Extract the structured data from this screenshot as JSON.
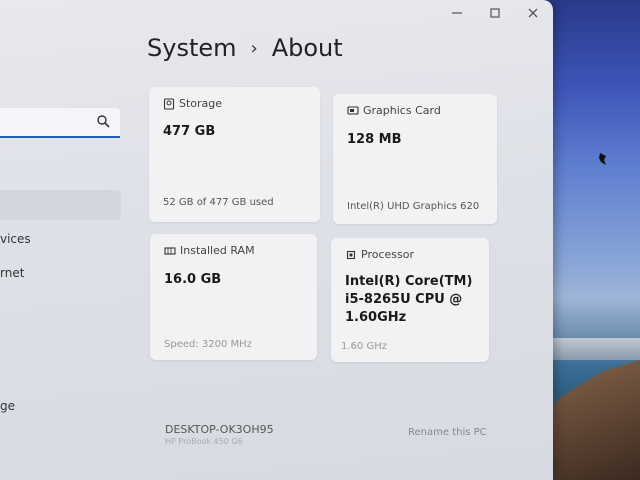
{
  "breadcrumb": {
    "parent": "System",
    "separator": "›",
    "current": "About"
  },
  "sidebar": {
    "items": [
      {
        "label": "vices"
      },
      {
        "label": "rnet"
      },
      {
        "label": "ge"
      }
    ]
  },
  "cards": {
    "storage": {
      "label": "Storage",
      "value": "477 GB",
      "detail": "52 GB of 477 GB used",
      "icon": "storage-icon"
    },
    "graphics": {
      "label": "Graphics Card",
      "value": "128 MB",
      "detail": "Intel(R) UHD Graphics 620",
      "icon": "graphics-card-icon"
    },
    "ram": {
      "label": "Installed RAM",
      "value": "16.0 GB",
      "detail": "Speed: 3200 MHz",
      "icon": "ram-icon"
    },
    "processor": {
      "label": "Processor",
      "value_lines": [
        "Intel(R) Core(TM)",
        "i5-8265U CPU @",
        "1.60GHz"
      ],
      "detail": "1.60 GHz",
      "icon": "processor-icon"
    }
  },
  "device": {
    "name": "DESKTOP-OK3OH95",
    "model": "HP ProBook 450 G6",
    "rename_label": "Rename this PC"
  },
  "colors": {
    "accent": "#1f5fb5"
  }
}
